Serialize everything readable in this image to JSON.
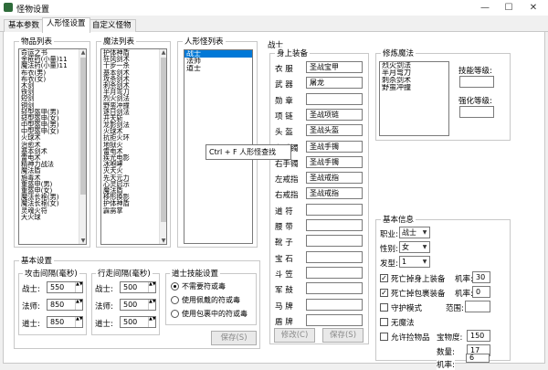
{
  "window": {
    "title": "怪物设置",
    "minimize": "—",
    "maximize": "☐",
    "close": "✕"
  },
  "tabs": [
    "基本参数",
    "人形怪设置",
    "自定义怪物"
  ],
  "item_list": {
    "title": "物品列表",
    "items": [
      "命运之书",
      "金疮药(小量)11",
      "魔法药(小量)11",
      "布衣(男)",
      "布衣(女)",
      "木剑",
      "铁剑",
      "短剑",
      "铜剑",
      "轻型盔甲(男)",
      "轻型盔甲(女)",
      "中型盔甲(男)",
      "中型盔甲(女)",
      "火球术",
      "治愈术",
      "基本剑术",
      "雷电术",
      "精神力战法",
      "魔法盾",
      "施毒术",
      "重盔甲(男)",
      "重盔甲(女)",
      "魔法长袍(男)",
      "魔法长袍(女)",
      "灵魂火符",
      "大火球"
    ]
  },
  "magic_list": {
    "title": "魔法列表",
    "items": [
      "护体神盾",
      "狂风剑术",
      "十步一杀",
      "基本剑术",
      "攻杀剑术",
      "刺杀剑术",
      "半月弯刀",
      "烈火剑法",
      "野蛮冲撞",
      "逐日剑法",
      "开天斩",
      "龙影剑法",
      "火球术",
      "抗拒火环",
      "地狱火",
      "雷电术",
      "疾光电影",
      "冰咆哮",
      "灭天火",
      "先天元力",
      "心灵启示",
      "魔法盾",
      "移形换影",
      "护体神盾",
      "霹雳掌"
    ]
  },
  "monster_list": {
    "title": "人形怪列表",
    "items": [
      "战士",
      "法师",
      "道士"
    ],
    "selected": 0
  },
  "warrior": {
    "title": "战士",
    "equip_title": "身上装备",
    "slots": [
      {
        "label": "衣  服",
        "value": "圣战宝甲"
      },
      {
        "label": "武  器",
        "value": "屠龙"
      },
      {
        "label": "勋  章",
        "value": ""
      },
      {
        "label": "项  链",
        "value": "圣战项链"
      },
      {
        "label": "头  盔",
        "value": "圣战头盔"
      },
      {
        "label": "左手镯",
        "value": "圣战手镯"
      },
      {
        "label": "右手镯",
        "value": "圣战手镯"
      },
      {
        "label": "左戒指",
        "value": "圣战戒指"
      },
      {
        "label": "右戒指",
        "value": "圣战戒指"
      },
      {
        "label": "道  符",
        "value": ""
      },
      {
        "label": "腰  带",
        "value": ""
      },
      {
        "label": "靴  子",
        "value": ""
      },
      {
        "label": "宝  石",
        "value": ""
      },
      {
        "label": "斗  笠",
        "value": ""
      },
      {
        "label": "军  鼓",
        "value": ""
      },
      {
        "label": "马  牌",
        "value": ""
      },
      {
        "label": "盾  牌",
        "value": ""
      }
    ],
    "modify_button": "修改(C)",
    "save_button": "保存(S)"
  },
  "cultivation": {
    "title": "修炼魔法",
    "items": [
      "烈火剑法",
      "半月弯刀",
      "刺杀剑术",
      "野蛮冲撞"
    ],
    "skill_level_label": "技能等级:",
    "strength_level_label": "强化等级:"
  },
  "basic_info": {
    "title": "基本信息",
    "job_label": "职业:",
    "job_value": "战士",
    "gender_label": "性别:",
    "gender_value": "女",
    "hair_label": "发型:",
    "hair_value": "1",
    "death_equip_label": "死亡掉身上装备",
    "death_equip_rate_label": "机率:",
    "death_equip_rate": "30",
    "death_bag_label": "死亡掉包裹装备",
    "death_bag_rate_label": "机率:",
    "death_bag_rate": "0",
    "guard_label": "守护模式",
    "range_label": "范围:",
    "range_value": "",
    "no_magic_label": "无魔法",
    "allow_pickup_label": "允许捡物品",
    "sensitivity_label": "宝物度:",
    "sensitivity_value": "150",
    "quantity_label": "数量:",
    "quantity_value": "17",
    "pickup_rate_label": "机率:",
    "pickup_rate_value": "6"
  },
  "basic_settings": {
    "title": "基本设置",
    "attack_interval_title": "攻击间隔(毫秒)",
    "walk_interval_title": "行走间隔(毫秒)",
    "attack": [
      {
        "label": "战士:",
        "value": "550"
      },
      {
        "label": "法师:",
        "value": "850"
      },
      {
        "label": "道士:",
        "value": "850"
      }
    ],
    "walk": [
      {
        "label": "战士:",
        "value": "500"
      },
      {
        "label": "法师:",
        "value": "500"
      },
      {
        "label": "道士:",
        "value": "500"
      }
    ],
    "taoist_title": "道士技能设置",
    "taoist_options": [
      "不需要符或毒",
      "使用佩戴的符或毒",
      "使用包裹中的符或毒"
    ],
    "taoist_selected": 0,
    "save_button": "保存(S)"
  },
  "tooltip": "Ctrl + F 人形怪查找"
}
